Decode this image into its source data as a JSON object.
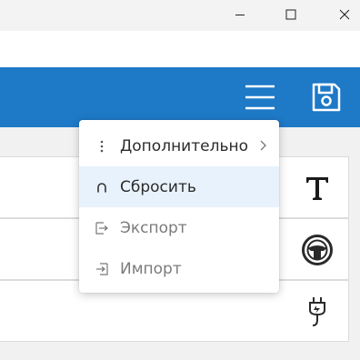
{
  "window": {
    "controls": [
      {
        "name": "minimize-button",
        "icon": "minimize-icon"
      },
      {
        "name": "maximize-button",
        "icon": "maximize-icon"
      },
      {
        "name": "close-button",
        "icon": "close-icon"
      }
    ]
  },
  "toolbar": {
    "color": "#1e79c7",
    "menu_icon": "hamburger-menu-icon",
    "save_icon": "save-icon"
  },
  "cards": [
    {
      "icon": "text-icon"
    },
    {
      "icon": "steering-wheel-icon"
    },
    {
      "icon": "plug-icon"
    }
  ],
  "menu": {
    "items": [
      {
        "label": "Дополнительно",
        "icon": "more-vertical-icon",
        "has_submenu": true,
        "state": "normal"
      },
      {
        "label": "Сбросить",
        "icon": "reset-icon",
        "state": "selected"
      },
      {
        "label": "Экспорт",
        "icon": "export-icon",
        "state": "disabled"
      },
      {
        "label": "Импорт",
        "icon": "import-icon",
        "state": "disabled"
      }
    ],
    "selected_bg": "#e8f2fc"
  }
}
